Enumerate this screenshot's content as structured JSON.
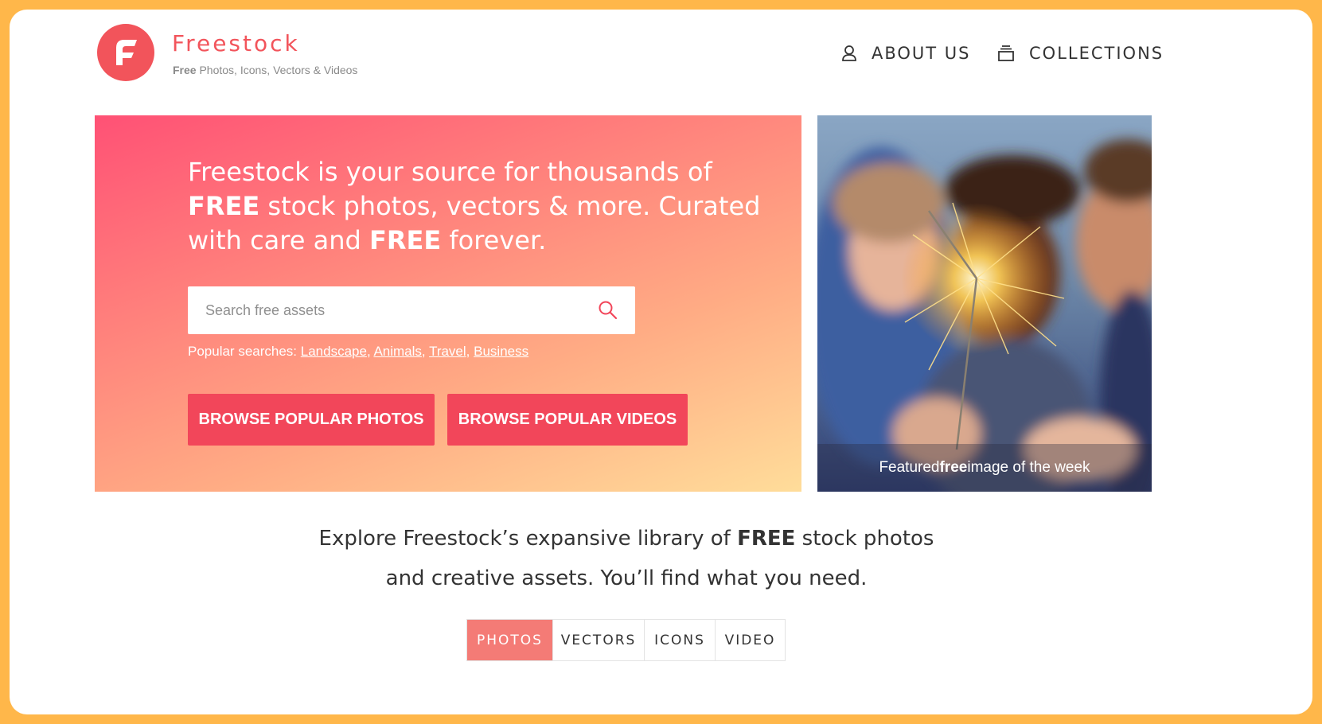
{
  "brand": {
    "name": "Freestock",
    "tagline_bold": "Free",
    "tagline_rest": " Photos, Icons, Vectors & Videos",
    "accent_color": "#f2545b"
  },
  "nav": {
    "about_label": "ABOUT US",
    "about_icon": "user-icon",
    "collections_label": "COLLECTIONS",
    "collections_icon": "collections-icon"
  },
  "hero": {
    "heading_part1": "Freestock is your source for thousands of ",
    "heading_bold1": "FREE",
    "heading_part2": " stock photos, vectors & more. Curated with care and ",
    "heading_bold2": "FREE",
    "heading_part3": " forever.",
    "search_placeholder": "Search free assets",
    "search_value": "",
    "popular_label": "Popular searches: ",
    "popular_searches": [
      "Landscape",
      "Animals",
      "Travel",
      "Business"
    ],
    "cta_photos": "BROWSE POPULAR PHOTOS",
    "cta_videos": "BROWSE POPULAR VIDEOS",
    "cta_color": "#f2465a"
  },
  "featured": {
    "caption_pre": "Featured ",
    "caption_bold": "free",
    "caption_post": " image of the week"
  },
  "explore": {
    "line1_pre": "Explore Freestock’s expansive library of ",
    "line1_bold": "FREE",
    "line1_post": " stock photos",
    "line2": "and creative assets. You’ll find what you need."
  },
  "tabs": {
    "items": [
      "PHOTOS",
      "VECTORS",
      "ICONS",
      "VIDEO"
    ],
    "active": "PHOTOS",
    "active_color": "#f47b76"
  }
}
